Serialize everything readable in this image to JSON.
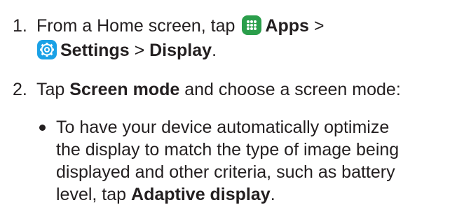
{
  "steps": [
    {
      "number": "1.",
      "line1": {
        "lead": "From a Home screen, tap ",
        "apps_label": "Apps",
        "separator": " >"
      },
      "line2": {
        "settings_label": "Settings",
        "separator": " > ",
        "display_label": "Display",
        "end": "."
      }
    },
    {
      "number": "2.",
      "lead": "Tap ",
      "screen_mode_label": "Screen mode",
      "trail": " and choose a screen mode:",
      "bullets": [
        {
          "lines": [
            "To have your device automatically optimize",
            "the display to match the type of image being",
            "displayed and other criteria, such as battery"
          ],
          "last_lead": "level, tap ",
          "last_bold": "Adaptive display",
          "last_end": "."
        }
      ]
    }
  ],
  "icons": {
    "apps": "apps-grid-icon",
    "settings": "settings-gear-icon"
  },
  "colors": {
    "text": "#231f20",
    "apps_icon": "#2b9e4b",
    "settings_icon": "#1aa1e6"
  }
}
